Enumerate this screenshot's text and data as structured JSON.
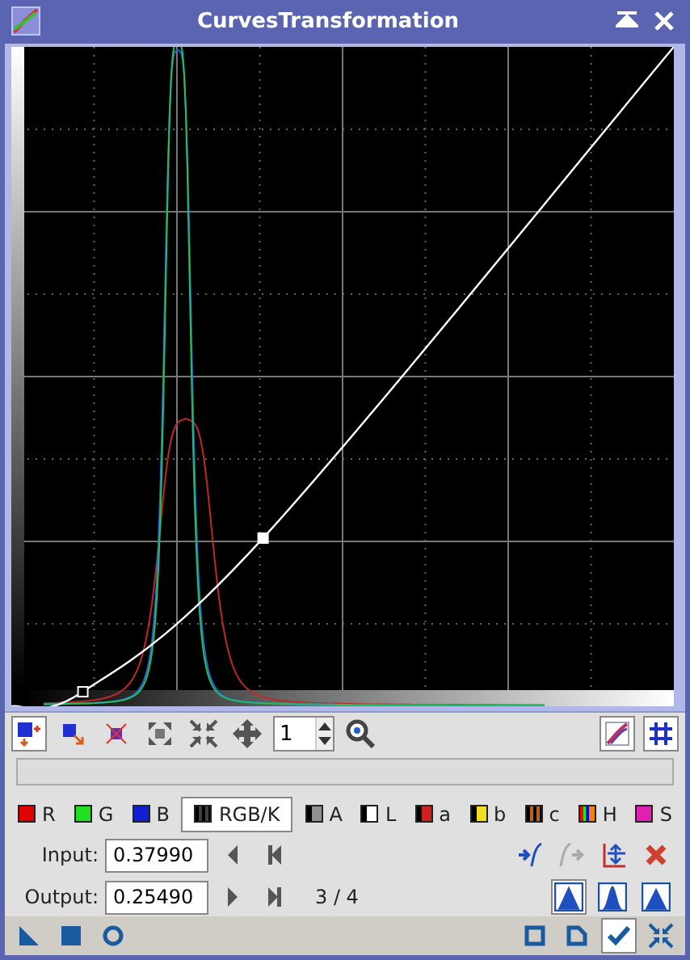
{
  "window": {
    "title": "CurvesTransformation"
  },
  "edit_modes": [
    {
      "selected": true
    },
    {
      "selected": false
    },
    {
      "selected": false
    }
  ],
  "zoom": {
    "value": "1"
  },
  "display_toggles": [
    {
      "on": true
    },
    {
      "on": true
    }
  ],
  "channels": [
    {
      "label": "R",
      "kind": "solid",
      "color": "#e00000",
      "selected": false
    },
    {
      "label": "G",
      "kind": "solid",
      "color": "#20e020",
      "selected": false
    },
    {
      "label": "B",
      "kind": "solid",
      "color": "#1020d0",
      "selected": false
    },
    {
      "label": "RGB/K",
      "kind": "stripes",
      "color": "#404040",
      "selected": true
    },
    {
      "label": "A",
      "kind": "gradient",
      "color": "#909090",
      "selected": false
    },
    {
      "label": "L",
      "kind": "gradient",
      "color": "#ffffff",
      "selected": false
    },
    {
      "label": "a",
      "kind": "gradient",
      "color": "#d02020",
      "selected": false
    },
    {
      "label": "b",
      "kind": "gradient",
      "color": "#f0e020",
      "selected": false
    },
    {
      "label": "c",
      "kind": "stripes",
      "color": "#c06020",
      "selected": false
    },
    {
      "label": "H",
      "kind": "rainbow",
      "color": "#ff8000",
      "selected": false
    },
    {
      "label": "S",
      "kind": "solid",
      "color": "#e020b0",
      "selected": false
    }
  ],
  "input": {
    "label": "Input:",
    "value": "0.37990"
  },
  "output": {
    "label": "Output:",
    "value": "0.25490"
  },
  "point_counter": "3 / 4",
  "interpolations": [
    {
      "selected": true
    },
    {
      "selected": false
    },
    {
      "selected": false
    }
  ]
}
